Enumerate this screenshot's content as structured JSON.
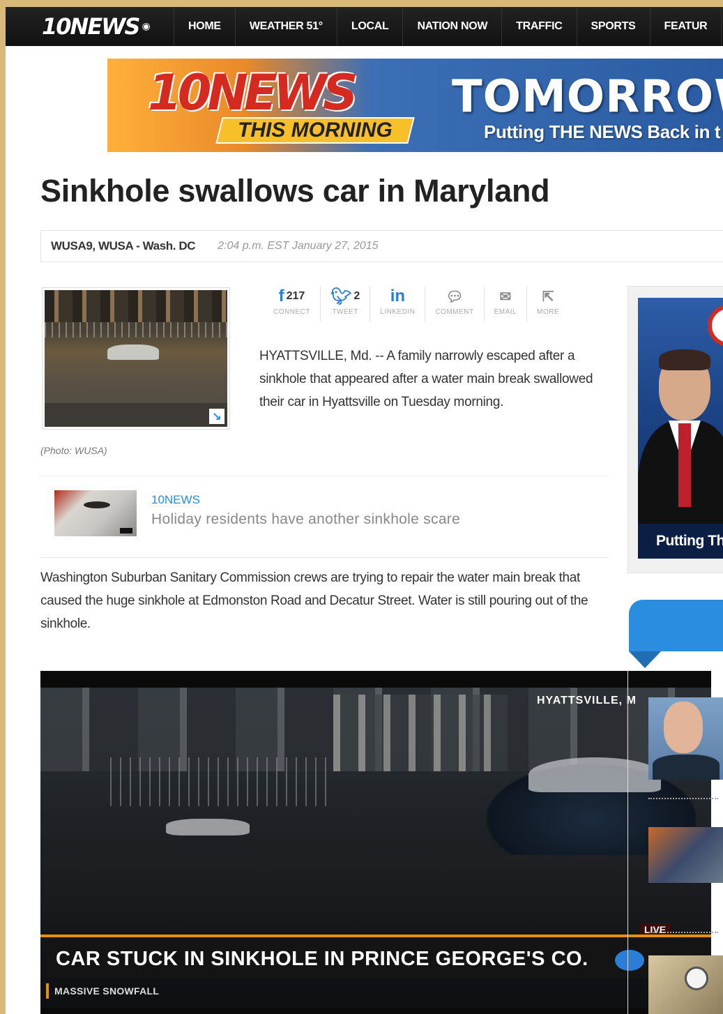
{
  "nav": {
    "logo": "10NEWS",
    "items": [
      "HOME",
      "WEATHER 51°",
      "LOCAL",
      "NATION NOW",
      "TRAFFIC",
      "SPORTS",
      "FEATUR"
    ]
  },
  "banner": {
    "logo": "10NEWS",
    "sub": "THIS MORNING",
    "headline": "TOMORROW",
    "tagline": "Putting THE NEWS Back in t"
  },
  "article": {
    "headline": "Sinkhole swallows car in Maryland",
    "source": "WUSA9, WUSA - Wash. DC",
    "timestamp": "2:04 p.m. EST January 27, 2015",
    "photo_credit": "(Photo: WUSA)",
    "lede": "HYATTSVILLE, Md. -- A family narrowly escaped after a sinkhole that appeared after a water main break swallowed their car in Hyattsville on Tuesday morning.",
    "body": "Washington Suburban Sanitary Commission crews are trying to repair the water main break that caused the huge sinkhole at Edmonston Road and Decatur Street. Water is still pouring out of the sinkhole."
  },
  "share": [
    {
      "icon": "f",
      "count": "217",
      "label": "CONNECT"
    },
    {
      "icon": "bird",
      "count": "2",
      "label": "TWEET"
    },
    {
      "icon": "in",
      "count": "",
      "label": "LINKEDIN"
    },
    {
      "icon": "comment",
      "count": "",
      "label": "COMMENT"
    },
    {
      "icon": "email",
      "count": "",
      "label": "EMAIL"
    },
    {
      "icon": "more",
      "count": "",
      "label": "MORE"
    }
  ],
  "related": {
    "kicker": "10NEWS",
    "title": "Holiday residents have another sinkhole scare"
  },
  "video": {
    "location": "HYATTSVILLE, M",
    "live": "LIVE",
    "lower_third": "CAR STUCK IN SINKHOLE IN PRINCE GEORGE'S CO.",
    "ticker": "MASSIVE SNOWFALL"
  },
  "sidebar": {
    "ad_caption": "Putting Th"
  }
}
